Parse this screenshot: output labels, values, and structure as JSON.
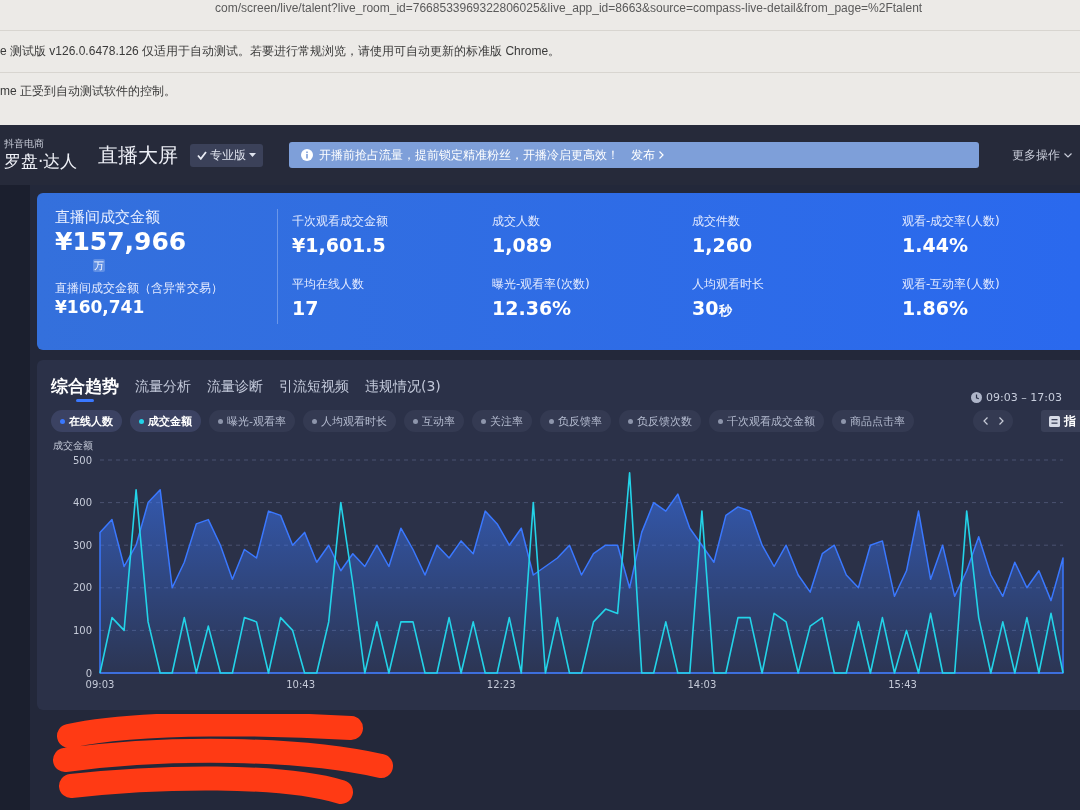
{
  "browser": {
    "address": "com/screen/live/talent?live_room_id=7668533969322806025&live_app_id=8663&source=compass-live-detail&from_page=%2Ftalent",
    "infobars": [
      {
        "text": "e 测试版 v126.0.6478.126 仅适用于自动测试。若要进行常规浏览，请使用可自动更新的标准版 Chrome。"
      },
      {
        "text": "me 正受到自动测试软件的控制。"
      }
    ]
  },
  "header": {
    "brand_small": "抖音电商",
    "brand": "罗盘·达人",
    "title": "直播大屏",
    "edition": "专业版",
    "notice": "开播前抢占流量，提前锁定精准粉丝，开播冷启更高效！",
    "notice_link": "发布",
    "more_actions": "更多操作"
  },
  "summary": {
    "main_label": "直播间成交金额",
    "main_value": "¥157,966",
    "unit_switch": "万",
    "sub_label": "直播间成交金额（含异常交易）",
    "sub_value": "¥160,741",
    "columns": [
      [
        {
          "label": "千次观看成交金额",
          "value": "¥1,601.5"
        },
        {
          "label": "平均在线人数",
          "value": "17"
        }
      ],
      [
        {
          "label": "成交人数",
          "value": "1,089"
        },
        {
          "label": "曝光-观看率(次数)",
          "value": "12.36%"
        }
      ],
      [
        {
          "label": "成交件数",
          "value": "1,260"
        },
        {
          "label": "人均观看时长",
          "value": "30",
          "unit": "秒"
        }
      ],
      [
        {
          "label": "观看-成交率(人数)",
          "value": "1.44%"
        },
        {
          "label": "观看-互动率(人数)",
          "value": "1.86%"
        }
      ]
    ]
  },
  "trend": {
    "tabs": [
      {
        "label": "综合趋势",
        "selected": true
      },
      {
        "label": "流量分析",
        "selected": false
      },
      {
        "label": "流量诊断",
        "selected": false
      },
      {
        "label": "引流短视频",
        "selected": false
      },
      {
        "label": "违规情况(3)",
        "selected": false
      }
    ],
    "time_range": "09:03 – 17:03",
    "chips": [
      {
        "label": "在线人数",
        "selected": true,
        "color": "#3a78ff"
      },
      {
        "label": "成交金额",
        "selected": true,
        "color": "#23d3e8"
      },
      {
        "label": "曝光-观看率",
        "selected": false
      },
      {
        "label": "人均观看时长",
        "selected": false
      },
      {
        "label": "互动率",
        "selected": false
      },
      {
        "label": "关注率",
        "selected": false
      },
      {
        "label": "负反馈率",
        "selected": false
      },
      {
        "label": "负反馈次数",
        "selected": false
      },
      {
        "label": "千次观看成交金额",
        "selected": false
      },
      {
        "label": "商品点击率",
        "selected": false
      }
    ],
    "metrics_button": "指",
    "chart_data": [
      {
        "type": "area",
        "ylabel": "成交金额",
        "x": [
          9.05,
          9.15,
          9.25,
          9.35,
          9.45,
          9.55,
          9.65,
          9.75,
          9.85,
          9.95,
          10.05,
          10.15,
          10.25,
          10.35,
          10.45,
          10.55,
          10.65,
          10.75,
          10.85,
          10.95,
          11.05,
          11.15,
          11.25,
          11.35,
          11.45,
          11.55,
          11.65,
          11.75,
          11.85,
          11.95,
          12.05,
          12.15,
          12.25,
          12.35,
          12.45,
          12.55,
          12.65,
          12.75,
          12.85,
          12.95,
          13.05,
          13.15,
          13.25,
          13.35,
          13.45,
          13.55,
          13.65,
          13.75,
          13.85,
          13.95,
          14.05,
          14.15,
          14.25,
          14.35,
          14.45,
          14.55,
          14.65,
          14.75,
          14.85,
          14.95,
          15.05,
          15.15,
          15.25,
          15.35,
          15.45,
          15.55,
          15.65,
          15.75,
          15.85,
          15.95,
          16.05,
          16.15,
          16.25,
          16.35,
          16.45,
          16.55,
          16.65,
          16.75,
          16.85,
          16.95,
          17.05
        ],
        "xlim": [
          9.05,
          17.05
        ],
        "ylim": [
          0,
          500
        ],
        "yticks": [
          0,
          100,
          200,
          300,
          400,
          500
        ],
        "xticks": [
          {
            "value": 9.05,
            "label": "09:03"
          },
          {
            "value": 10.717,
            "label": "10:43"
          },
          {
            "value": 12.383,
            "label": "12:23"
          },
          {
            "value": 14.05,
            "label": "14:03"
          },
          {
            "value": 15.717,
            "label": "15:43"
          }
        ],
        "grid": true,
        "series": [
          {
            "type": "area",
            "color": "#3a78ff",
            "values": [
              330,
              360,
              250,
              300,
              400,
              430,
              200,
              260,
              350,
              360,
              300,
              220,
              290,
              270,
              380,
              370,
              300,
              330,
              260,
              300,
              240,
              280,
              250,
              300,
              250,
              340,
              290,
              230,
              300,
              270,
              310,
              280,
              380,
              350,
              300,
              340,
              230,
              250,
              270,
              300,
              230,
              280,
              300,
              300,
              200,
              330,
              400,
              380,
              420,
              340,
              300,
              260,
              370,
              390,
              380,
              300,
              250,
              300,
              230,
              190,
              280,
              300,
              230,
              200,
              300,
              310,
              180,
              240,
              380,
              220,
              300,
              180,
              240,
              320,
              230,
              180,
              260,
              200,
              240,
              170,
              270
            ]
          },
          {
            "type": "line",
            "color": "#23d3e8",
            "values": [
              0,
              130,
              100,
              430,
              120,
              0,
              0,
              130,
              0,
              110,
              0,
              0,
              130,
              120,
              0,
              130,
              100,
              0,
              0,
              120,
              400,
              210,
              0,
              120,
              0,
              120,
              120,
              0,
              0,
              130,
              0,
              120,
              0,
              0,
              130,
              0,
              400,
              0,
              130,
              0,
              0,
              120,
              150,
              140,
              470,
              0,
              0,
              120,
              0,
              0,
              380,
              0,
              0,
              130,
              130,
              0,
              140,
              120,
              0,
              110,
              130,
              0,
              0,
              120,
              0,
              130,
              0,
              100,
              0,
              140,
              0,
              0,
              380,
              130,
              0,
              120,
              0,
              130,
              0,
              140,
              0
            ]
          }
        ]
      }
    ]
  }
}
